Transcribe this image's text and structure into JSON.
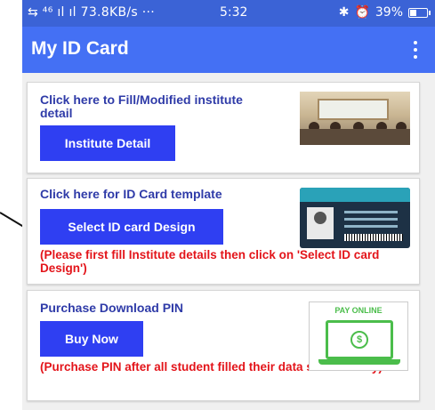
{
  "status_bar": {
    "network": "⇆ ⁴⁶ ıl ıl 73.8KB/s ···",
    "time": "5:32",
    "bluetooth": "✱",
    "alarm": "⏰",
    "battery": "39%",
    "battery_level": 0.39
  },
  "app_bar": {
    "title": "My ID Card",
    "menu_icon": "more-vert-icon"
  },
  "cards": {
    "institute": {
      "heading": "Click here to Fill/Modified institute detail",
      "button": "Institute Detail"
    },
    "template": {
      "heading": "Click here for ID Card template",
      "button": "Select ID card Design",
      "note": "(Please first fill Institute details then click on 'Select ID card Design')"
    },
    "pin": {
      "heading": "Purchase Download PIN",
      "button": "Buy Now",
      "note": "(Purchase PIN after all student filled their data successfully)",
      "pay_label": "PAY ONLINE",
      "pay_symbol": "$"
    }
  },
  "colors": {
    "app_bar": "#4470f4",
    "button": "#2f3ff2",
    "heading": "#2f3ba8",
    "warning": "#e3141a"
  }
}
